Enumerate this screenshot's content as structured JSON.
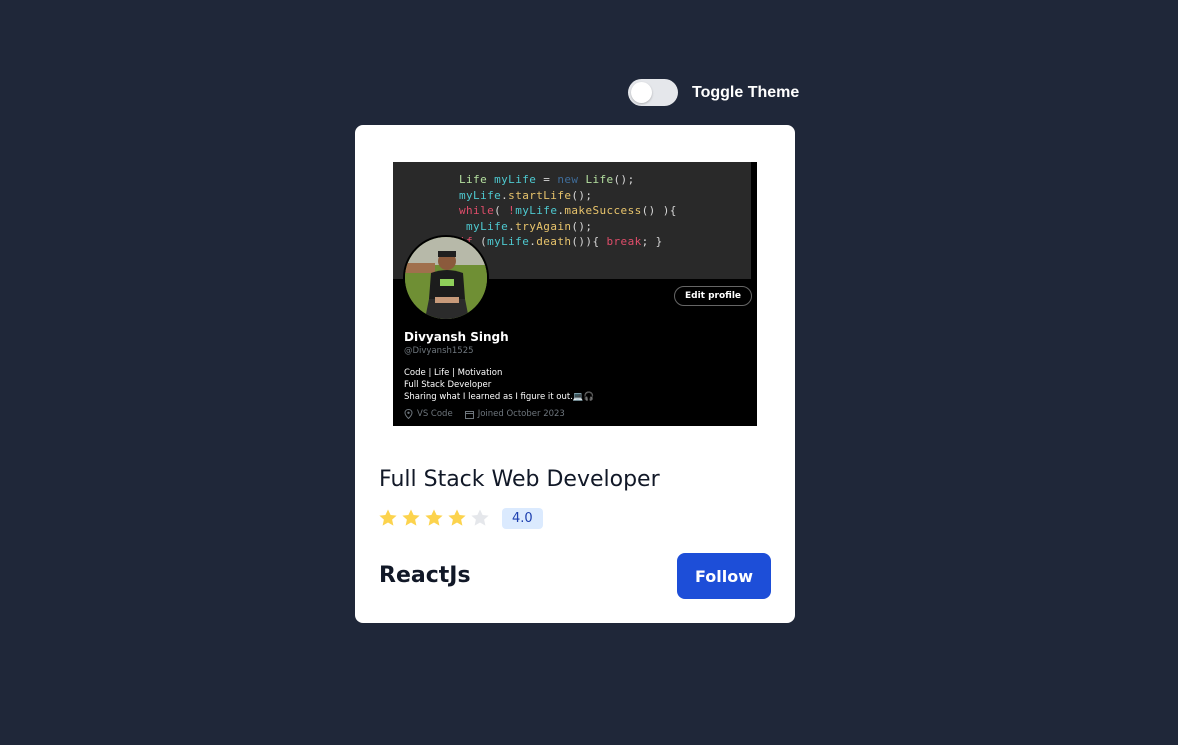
{
  "toggle": {
    "label": "Toggle Theme",
    "checked": false
  },
  "card": {
    "image": {
      "code_lines": [
        [
          [
            "Life ",
            "kw-green"
          ],
          [
            "myLife",
            "kw-cyan"
          ],
          [
            " = ",
            "kw-white"
          ],
          [
            "new ",
            "kw-blue"
          ],
          [
            "Life",
            "kw-green"
          ],
          [
            "();",
            "kw-white"
          ]
        ],
        [
          [
            "myLife",
            "kw-cyan"
          ],
          [
            ".",
            "kw-white"
          ],
          [
            "startLife",
            "kw-yellow"
          ],
          [
            "();",
            "kw-white"
          ]
        ],
        [
          [
            "while",
            "kw-red"
          ],
          [
            "( ",
            "kw-white"
          ],
          [
            "!",
            "kw-red"
          ],
          [
            "myLife",
            "kw-cyan"
          ],
          [
            ".",
            "kw-white"
          ],
          [
            "makeSuccess",
            "kw-yellow"
          ],
          [
            "() ){",
            "kw-white"
          ]
        ],
        [
          [
            " myLife",
            "kw-cyan"
          ],
          [
            ".",
            "kw-white"
          ],
          [
            "tryAgain",
            "kw-yellow"
          ],
          [
            "();",
            "kw-white"
          ]
        ],
        [
          [
            "if",
            "kw-red"
          ],
          [
            " (",
            "kw-white"
          ],
          [
            "myLife",
            "kw-cyan"
          ],
          [
            ".",
            "kw-white"
          ],
          [
            "death",
            "kw-yellow"
          ],
          [
            "()){ ",
            "kw-white"
          ],
          [
            "break",
            "kw-red"
          ],
          [
            "; }",
            "kw-white"
          ]
        ]
      ],
      "edit_profile": "Edit profile",
      "name": "Divyansh Singh",
      "handle": "@Divyansh1525",
      "bio": [
        "Code | Life | Motivation",
        "Full Stack Developer",
        "Sharing what I learned as I figure it out.💻🎧"
      ],
      "location": "VS Code",
      "joined": "Joined October 2023"
    },
    "title": "Full Stack Web Developer",
    "rating": {
      "value": 4,
      "max": 5,
      "label": "4.0"
    },
    "tech": "ReactJs",
    "follow_label": "Follow",
    "colors": {
      "star_filled": "#fcd34d",
      "star_empty": "#e5e7eb",
      "accent": "#1d4ed8"
    }
  }
}
